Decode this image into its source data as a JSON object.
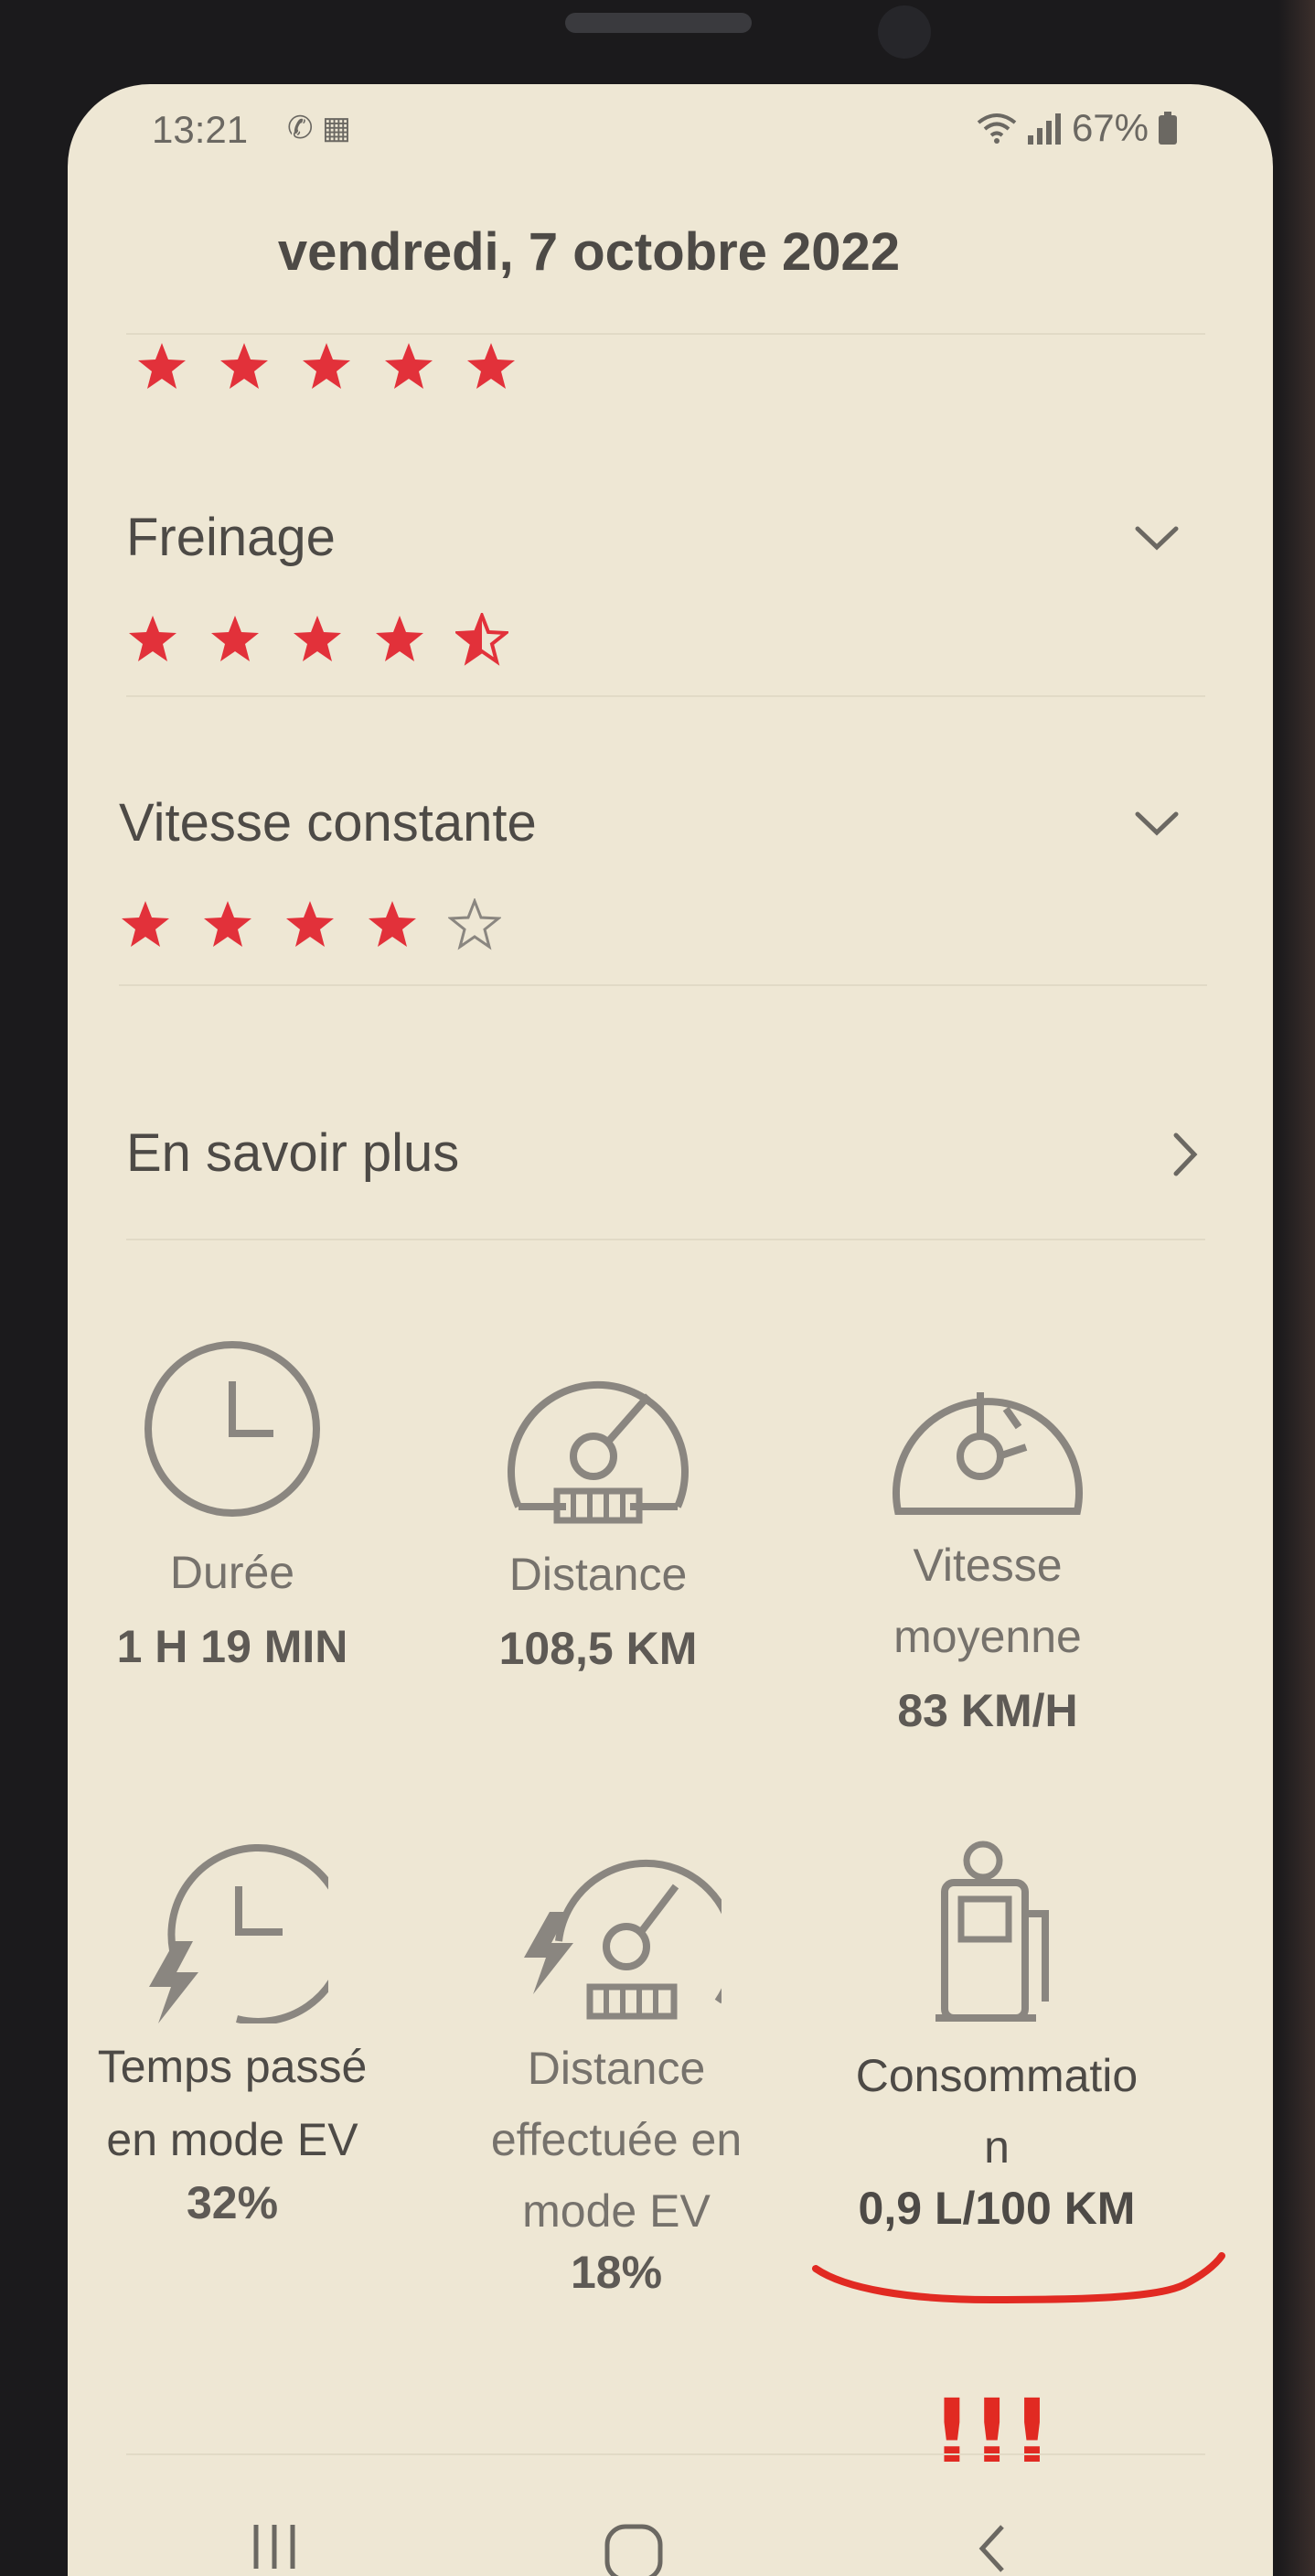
{
  "status_bar": {
    "time": "13:21",
    "notification_glyphs": "✆ ▦",
    "battery": "67%"
  },
  "header": {
    "date": "vendredi, 7 octobre 2022"
  },
  "ratings": [
    {
      "title": "",
      "stars": 5
    },
    {
      "title": "Freinage",
      "stars": 4.5
    },
    {
      "title": "Vitesse constante",
      "stars": 4
    }
  ],
  "learn_more": {
    "label": "En savoir plus"
  },
  "stats": [
    {
      "icon": "clock-icon",
      "label": "Durée",
      "value": "1 H 19 MIN"
    },
    {
      "icon": "speedometer-icon",
      "label": "Distance",
      "value": "108,5 KM"
    },
    {
      "icon": "speedometer-clock-icon",
      "label_lines": [
        "Vitesse",
        "moyenne"
      ],
      "value": "83 KM/H"
    },
    {
      "icon": "ev-clock-icon",
      "label_lines": [
        "Temps passé",
        "en mode EV"
      ],
      "value": "32%"
    },
    {
      "icon": "ev-speedometer-icon",
      "label_lines": [
        "Distance",
        "effectuée en",
        "mode EV"
      ],
      "value": "18%"
    },
    {
      "icon": "fuel-pump-icon",
      "label_lines": [
        "Consommatio",
        "n"
      ],
      "value": "0,9 L/100 KM"
    }
  ],
  "annotation": {
    "text": "!!!",
    "color": "#e12a22"
  },
  "colors": {
    "star": "#e2313a",
    "background": "#eee7d4",
    "icon": "#8a8680"
  }
}
